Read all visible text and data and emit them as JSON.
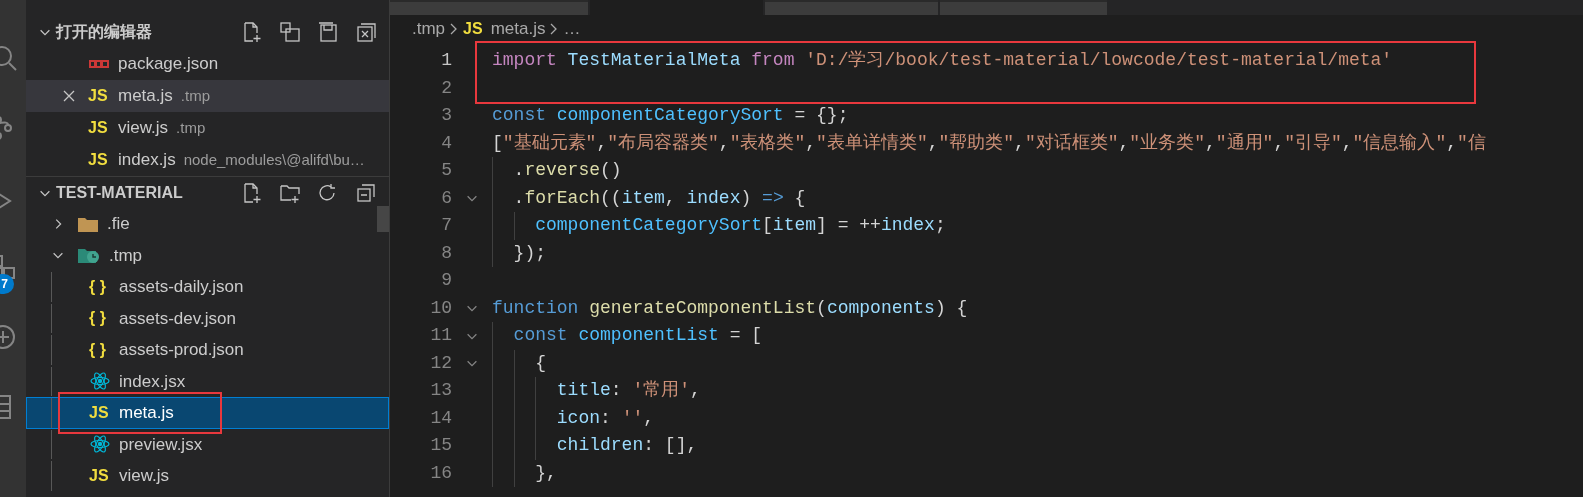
{
  "activity_bar": {
    "badge": "7"
  },
  "sidebar": {
    "open_editors": {
      "title": "打开的编辑器",
      "expanded": true,
      "items": [
        {
          "kind": "npm",
          "name": "package.json",
          "selected": false
        },
        {
          "kind": "glyph",
          "glyph": "JS",
          "name": "meta.js",
          "description": ".tmp",
          "selected": true
        },
        {
          "kind": "glyph",
          "glyph": "JS",
          "name": "view.js",
          "description": ".tmp",
          "selected": false
        },
        {
          "kind": "glyph",
          "glyph": "JS",
          "name": "index.js",
          "description": "node_modules\\@alifd\\bu…",
          "selected": false
        }
      ]
    },
    "explorer": {
      "title": "TEST-MATERIAL",
      "expanded": true,
      "items": [
        {
          "kind": "folder",
          "name": ".fie",
          "expanded": false,
          "selected": false,
          "boxed": false
        },
        {
          "kind": "folder-clock",
          "name": ".tmp",
          "expanded": true,
          "selected": false,
          "boxed": false,
          "children": [
            {
              "kind": "glyph",
              "glyph": "{ }",
              "name": "assets-daily.json",
              "selected": false,
              "boxed": false
            },
            {
              "kind": "glyph",
              "glyph": "{ }",
              "name": "assets-dev.json",
              "selected": false,
              "boxed": false
            },
            {
              "kind": "glyph",
              "glyph": "{ }",
              "name": "assets-prod.json",
              "selected": false,
              "boxed": false
            },
            {
              "kind": "react",
              "name": "index.jsx",
              "selected": false,
              "boxed": false
            },
            {
              "kind": "glyph",
              "glyph": "JS",
              "name": "meta.js",
              "selected": true,
              "boxed": true
            },
            {
              "kind": "react",
              "name": "preview.jsx",
              "selected": false,
              "boxed": false
            },
            {
              "kind": "glyph",
              "glyph": "JS",
              "name": "view.js",
              "selected": false,
              "boxed": false
            }
          ]
        }
      ]
    }
  },
  "editor": {
    "tabs": [
      {
        "selected": false
      },
      {
        "selected": true
      },
      {
        "selected": false
      },
      {
        "selected": false
      }
    ],
    "breadcrumb": [
      {
        "text": ".tmp"
      },
      {
        "glyph": "JS",
        "text": "meta.js"
      },
      {
        "text": "…"
      }
    ],
    "lines": [
      {
        "n": "1",
        "current": true,
        "fold": false,
        "boxed": true,
        "tokens": [
          {
            "kind": "ctrl",
            "t": "import"
          },
          {
            "kind": "var",
            "t": " TestMaterialMeta"
          },
          {
            "kind": "ctrl",
            "t": " from"
          },
          {
            "kind": "str",
            "t": " 'D:/学习/book/test-material/lowcode/test-material/meta'"
          }
        ]
      },
      {
        "n": "2",
        "current": false,
        "fold": false,
        "boxed": true
      },
      {
        "n": "3",
        "current": false,
        "fold": false,
        "boxed": false,
        "tokens": [
          {
            "kind": "kw",
            "t": "const"
          },
          {
            "kind": "const",
            "t": " componentCategorySort"
          },
          {
            "kind": "p",
            "t": " = {};"
          }
        ]
      },
      {
        "n": "4",
        "current": false,
        "fold": false,
        "boxed": false,
        "tokens": [
          {
            "kind": "p",
            "t": "["
          },
          {
            "kind": "str",
            "t": "\"基础元素\""
          },
          {
            "kind": "p",
            "t": ","
          },
          {
            "kind": "str",
            "t": "\"布局容器类\""
          },
          {
            "kind": "p",
            "t": ","
          },
          {
            "kind": "str",
            "t": "\"表格类\""
          },
          {
            "kind": "p",
            "t": ","
          },
          {
            "kind": "str",
            "t": "\"表单详情类\""
          },
          {
            "kind": "p",
            "t": ","
          },
          {
            "kind": "str",
            "t": "\"帮助类\""
          },
          {
            "kind": "p",
            "t": ","
          },
          {
            "kind": "str",
            "t": "\"对话框类\""
          },
          {
            "kind": "p",
            "t": ","
          },
          {
            "kind": "str",
            "t": "\"业务类\""
          },
          {
            "kind": "p",
            "t": ","
          },
          {
            "kind": "str",
            "t": "\"通用\""
          },
          {
            "kind": "p",
            "t": ","
          },
          {
            "kind": "str",
            "t": "\"引导\""
          },
          {
            "kind": "p",
            "t": ","
          },
          {
            "kind": "str",
            "t": "\"信息输入\""
          },
          {
            "kind": "p",
            "t": ","
          },
          {
            "kind": "str",
            "t": "\"信"
          }
        ]
      },
      {
        "n": "5",
        "current": false,
        "fold": false,
        "boxed": false,
        "tokens": [
          {
            "kind": "p",
            "t": "  ."
          },
          {
            "kind": "fn",
            "t": "reverse"
          },
          {
            "kind": "p",
            "t": "()"
          }
        ]
      },
      {
        "n": "6",
        "current": false,
        "fold": true,
        "boxed": false,
        "tokens": [
          {
            "kind": "p",
            "t": "  ."
          },
          {
            "kind": "fn",
            "t": "forEach"
          },
          {
            "kind": "p",
            "t": "(("
          },
          {
            "kind": "var",
            "t": "item"
          },
          {
            "kind": "p",
            "t": ", "
          },
          {
            "kind": "var",
            "t": "index"
          },
          {
            "kind": "p",
            "t": ") "
          },
          {
            "kind": "kw",
            "t": "=>"
          },
          {
            "kind": "p",
            "t": " {"
          }
        ]
      },
      {
        "n": "7",
        "current": false,
        "fold": false,
        "boxed": false,
        "tokens": [
          {
            "kind": "const",
            "t": "    componentCategorySort"
          },
          {
            "kind": "p",
            "t": "["
          },
          {
            "kind": "var",
            "t": "item"
          },
          {
            "kind": "p",
            "t": "] = ++"
          },
          {
            "kind": "var",
            "t": "index"
          },
          {
            "kind": "p",
            "t": ";"
          }
        ]
      },
      {
        "n": "8",
        "current": false,
        "fold": false,
        "boxed": false,
        "tokens": [
          {
            "kind": "p",
            "t": "  });"
          }
        ]
      },
      {
        "n": "9",
        "current": false,
        "fold": false,
        "boxed": false
      },
      {
        "n": "10",
        "current": false,
        "fold": true,
        "boxed": false,
        "tokens": [
          {
            "kind": "kw",
            "t": "function"
          },
          {
            "kind": "fn",
            "t": " generateComponentList"
          },
          {
            "kind": "p",
            "t": "("
          },
          {
            "kind": "var",
            "t": "components"
          },
          {
            "kind": "p",
            "t": ") {"
          }
        ]
      },
      {
        "n": "11",
        "current": false,
        "fold": true,
        "boxed": false,
        "tokens": [
          {
            "kind": "kw",
            "t": "  const"
          },
          {
            "kind": "const",
            "t": " componentList"
          },
          {
            "kind": "p",
            "t": " = ["
          }
        ]
      },
      {
        "n": "12",
        "current": false,
        "fold": true,
        "boxed": false,
        "tokens": [
          {
            "kind": "p",
            "t": "    {"
          }
        ]
      },
      {
        "n": "13",
        "current": false,
        "fold": false,
        "boxed": false,
        "tokens": [
          {
            "kind": "var",
            "t": "      title"
          },
          {
            "kind": "p",
            "t": ": "
          },
          {
            "kind": "str",
            "t": "'常用'"
          },
          {
            "kind": "p",
            "t": ","
          }
        ]
      },
      {
        "n": "14",
        "current": false,
        "fold": false,
        "boxed": false,
        "tokens": [
          {
            "kind": "var",
            "t": "      icon"
          },
          {
            "kind": "p",
            "t": ": "
          },
          {
            "kind": "str",
            "t": "''"
          },
          {
            "kind": "p",
            "t": ","
          }
        ]
      },
      {
        "n": "15",
        "current": false,
        "fold": false,
        "boxed": false,
        "tokens": [
          {
            "kind": "var",
            "t": "      children"
          },
          {
            "kind": "p",
            "t": ": [],"
          }
        ]
      },
      {
        "n": "16",
        "current": false,
        "fold": false,
        "boxed": false,
        "tokens": [
          {
            "kind": "p",
            "t": "    },"
          }
        ]
      }
    ]
  }
}
